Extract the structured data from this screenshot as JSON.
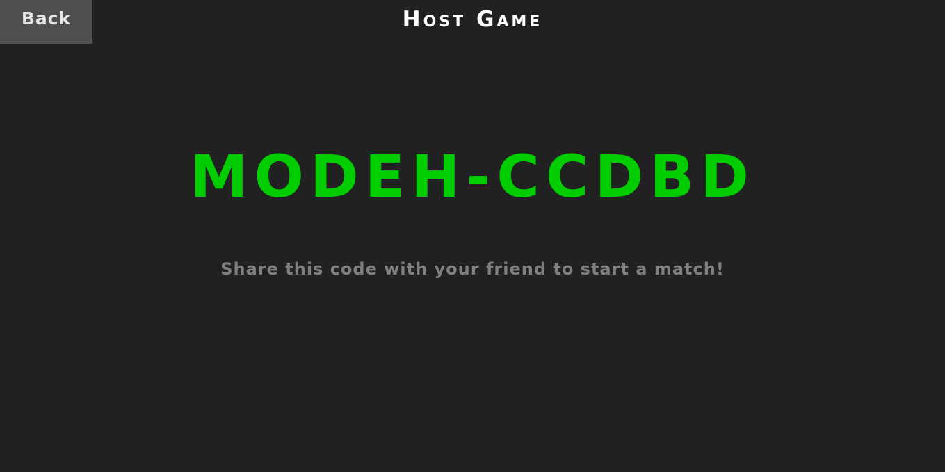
{
  "header": {
    "back_label": "Back",
    "title": "Host Game"
  },
  "main": {
    "room_code": "MODEH-CCDBD",
    "hint": "Share this code with your friend to start a match!"
  },
  "colors": {
    "background": "#212121",
    "back_button": "#4f4f4f",
    "code": "#00cc00",
    "title": "#ffffff",
    "hint": "#808080"
  }
}
